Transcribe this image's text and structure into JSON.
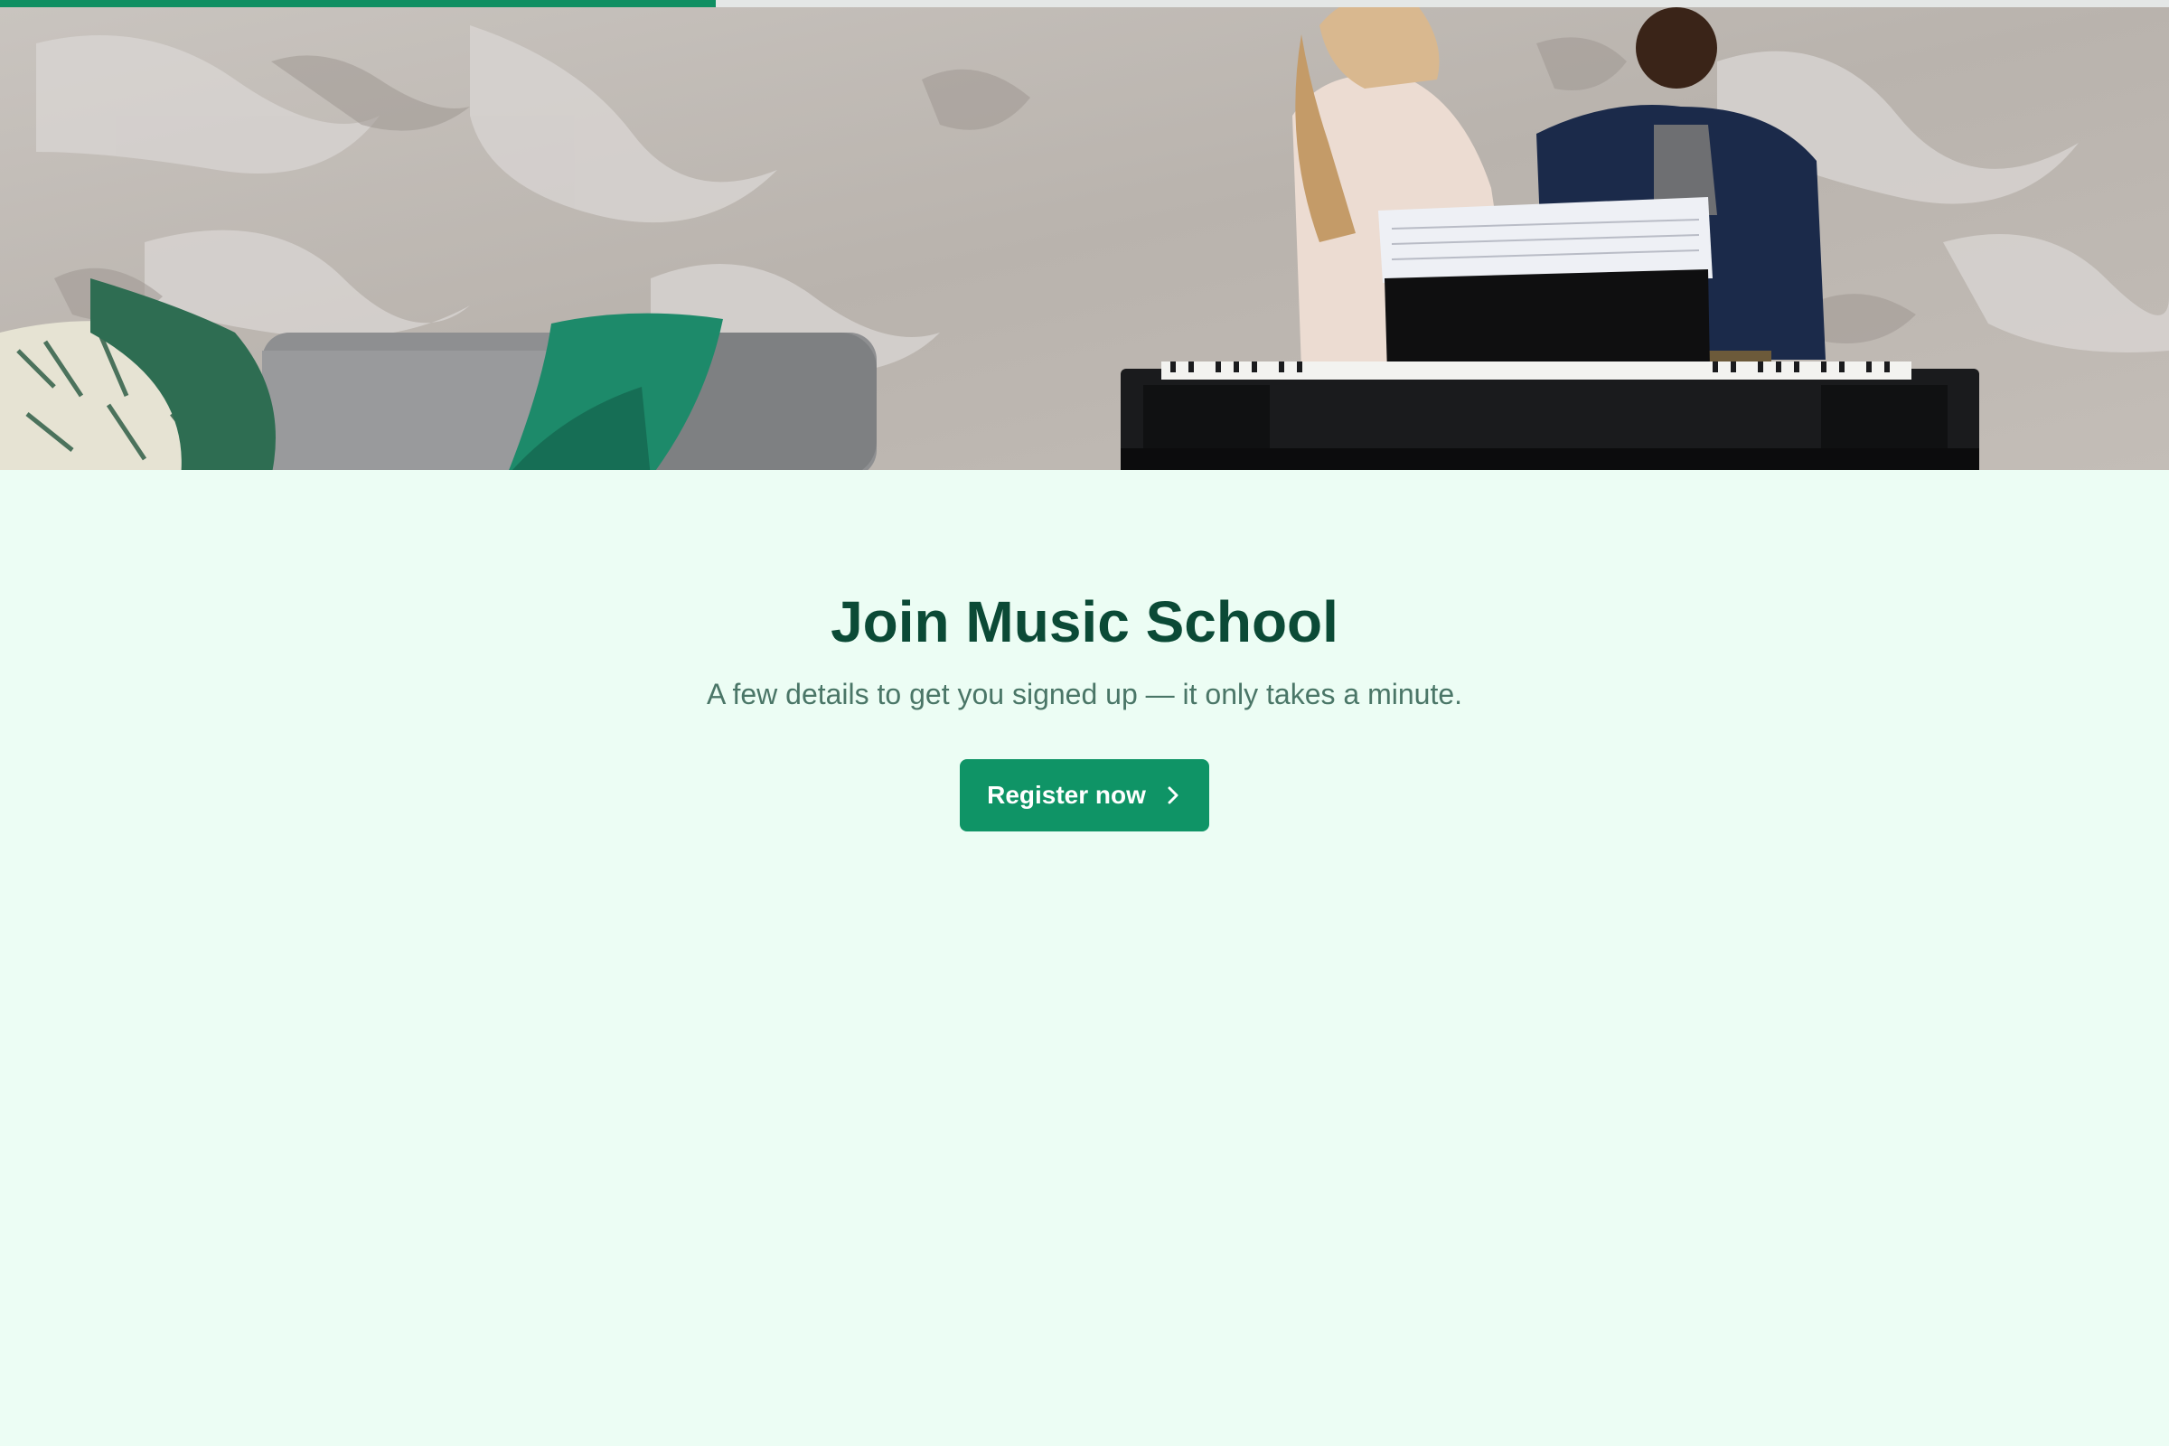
{
  "progress": {
    "value": 0.33
  },
  "hero": {
    "description_icon": "music-lesson-photo"
  },
  "main": {
    "title": "Join Music School",
    "subtitle": "A few details to get you signed up — it only takes a minute.",
    "cta_label": "Register now",
    "cta_icon": "chevron-right-icon"
  },
  "colors": {
    "background": "#ecfdf4",
    "accent": "#0f9466",
    "title": "#0b4a36",
    "subtitle": "#4a7667",
    "progress_track": "#e4e7e6"
  }
}
